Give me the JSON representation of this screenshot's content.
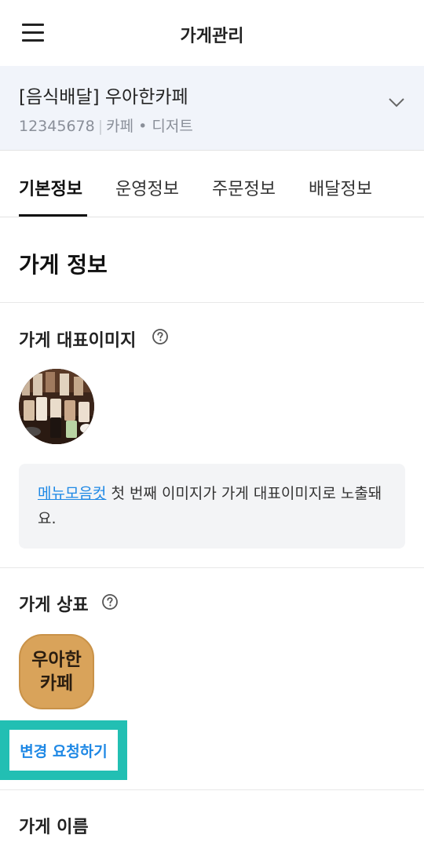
{
  "header": {
    "title": "가게관리"
  },
  "store": {
    "name": "[음식배달] 우아한카페",
    "id": "12345678",
    "separator": "|",
    "category": "카페 • 디저트"
  },
  "tabs": [
    {
      "label": "기본정보",
      "active": true
    },
    {
      "label": "운영정보",
      "active": false
    },
    {
      "label": "주문정보",
      "active": false
    },
    {
      "label": "배달정보",
      "active": false
    }
  ],
  "section": {
    "title": "가게 정보"
  },
  "representative_image": {
    "label": "가게 대표이미지",
    "notice_link": "메뉴모음컷",
    "notice_text": " 첫 번째 이미지가 가게 대표이미지로 노출돼요."
  },
  "brand_logo": {
    "label": "가게 상표",
    "logo_line1": "우아한",
    "logo_line2": "카페",
    "change_button": "변경 요청하기"
  },
  "store_name_field": {
    "label": "가게 이름"
  },
  "colors": {
    "accent": "#1e88e5",
    "highlight": "#22bfb3",
    "store_bg": "#f1f4fa"
  },
  "icons": {
    "menu": "hamburger-icon",
    "dropdown": "chevron-down-icon",
    "help": "question-circle-icon"
  }
}
